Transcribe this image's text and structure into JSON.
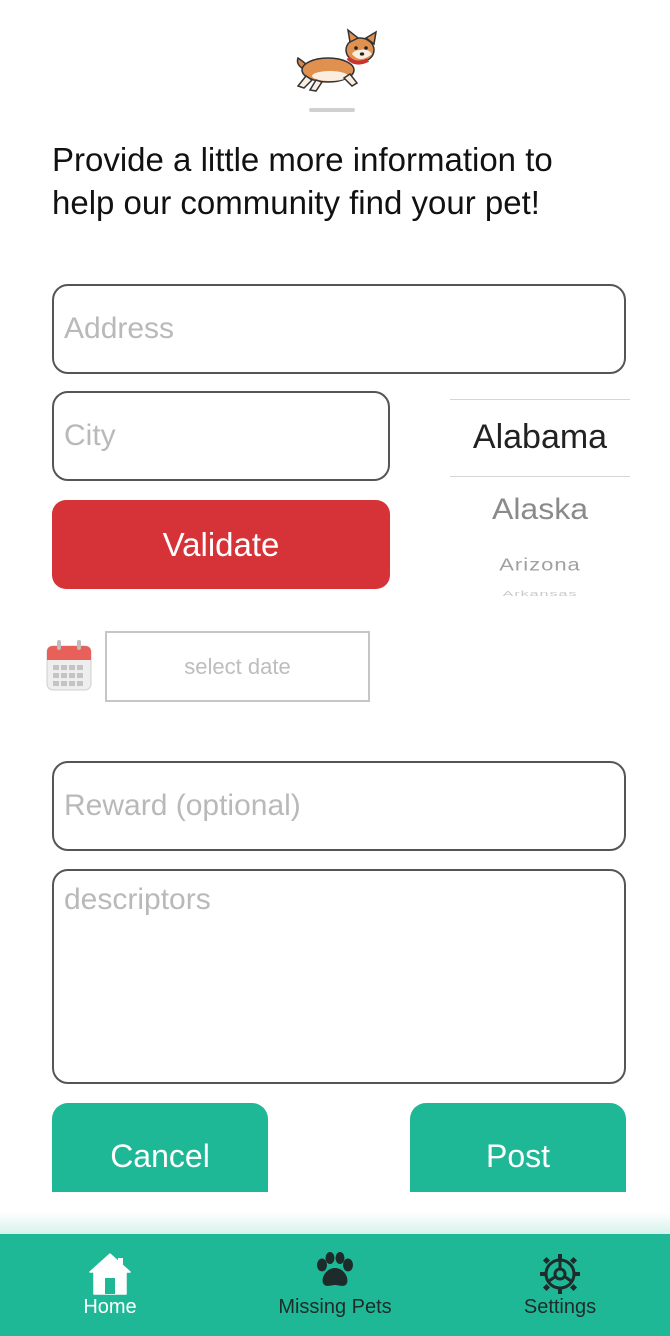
{
  "intro": {
    "text": "Provide a little more information to help our community find your pet!"
  },
  "form": {
    "address_placeholder": "Address",
    "city_placeholder": "City",
    "validate_label": "Validate",
    "date_placeholder": "select date",
    "reward_placeholder": "Reward (optional)",
    "descriptors_placeholder": "descriptors",
    "cancel_label": "Cancel",
    "post_label": "Post"
  },
  "state_picker": {
    "selected": "Alabama",
    "options": [
      "Alabama",
      "Alaska",
      "Arizona",
      "Arkansas"
    ]
  },
  "tabbar": {
    "items": [
      {
        "label": "Home",
        "icon": "home-icon",
        "active": true
      },
      {
        "label": "Missing Pets",
        "icon": "paw-icon",
        "active": false
      },
      {
        "label": "Settings",
        "icon": "gear-icon",
        "active": false
      }
    ]
  },
  "colors": {
    "accent_green": "#1fb896",
    "validate_red": "#d63338",
    "active_tab": "#ffffff",
    "inactive_tab": "#1d2b2a"
  }
}
